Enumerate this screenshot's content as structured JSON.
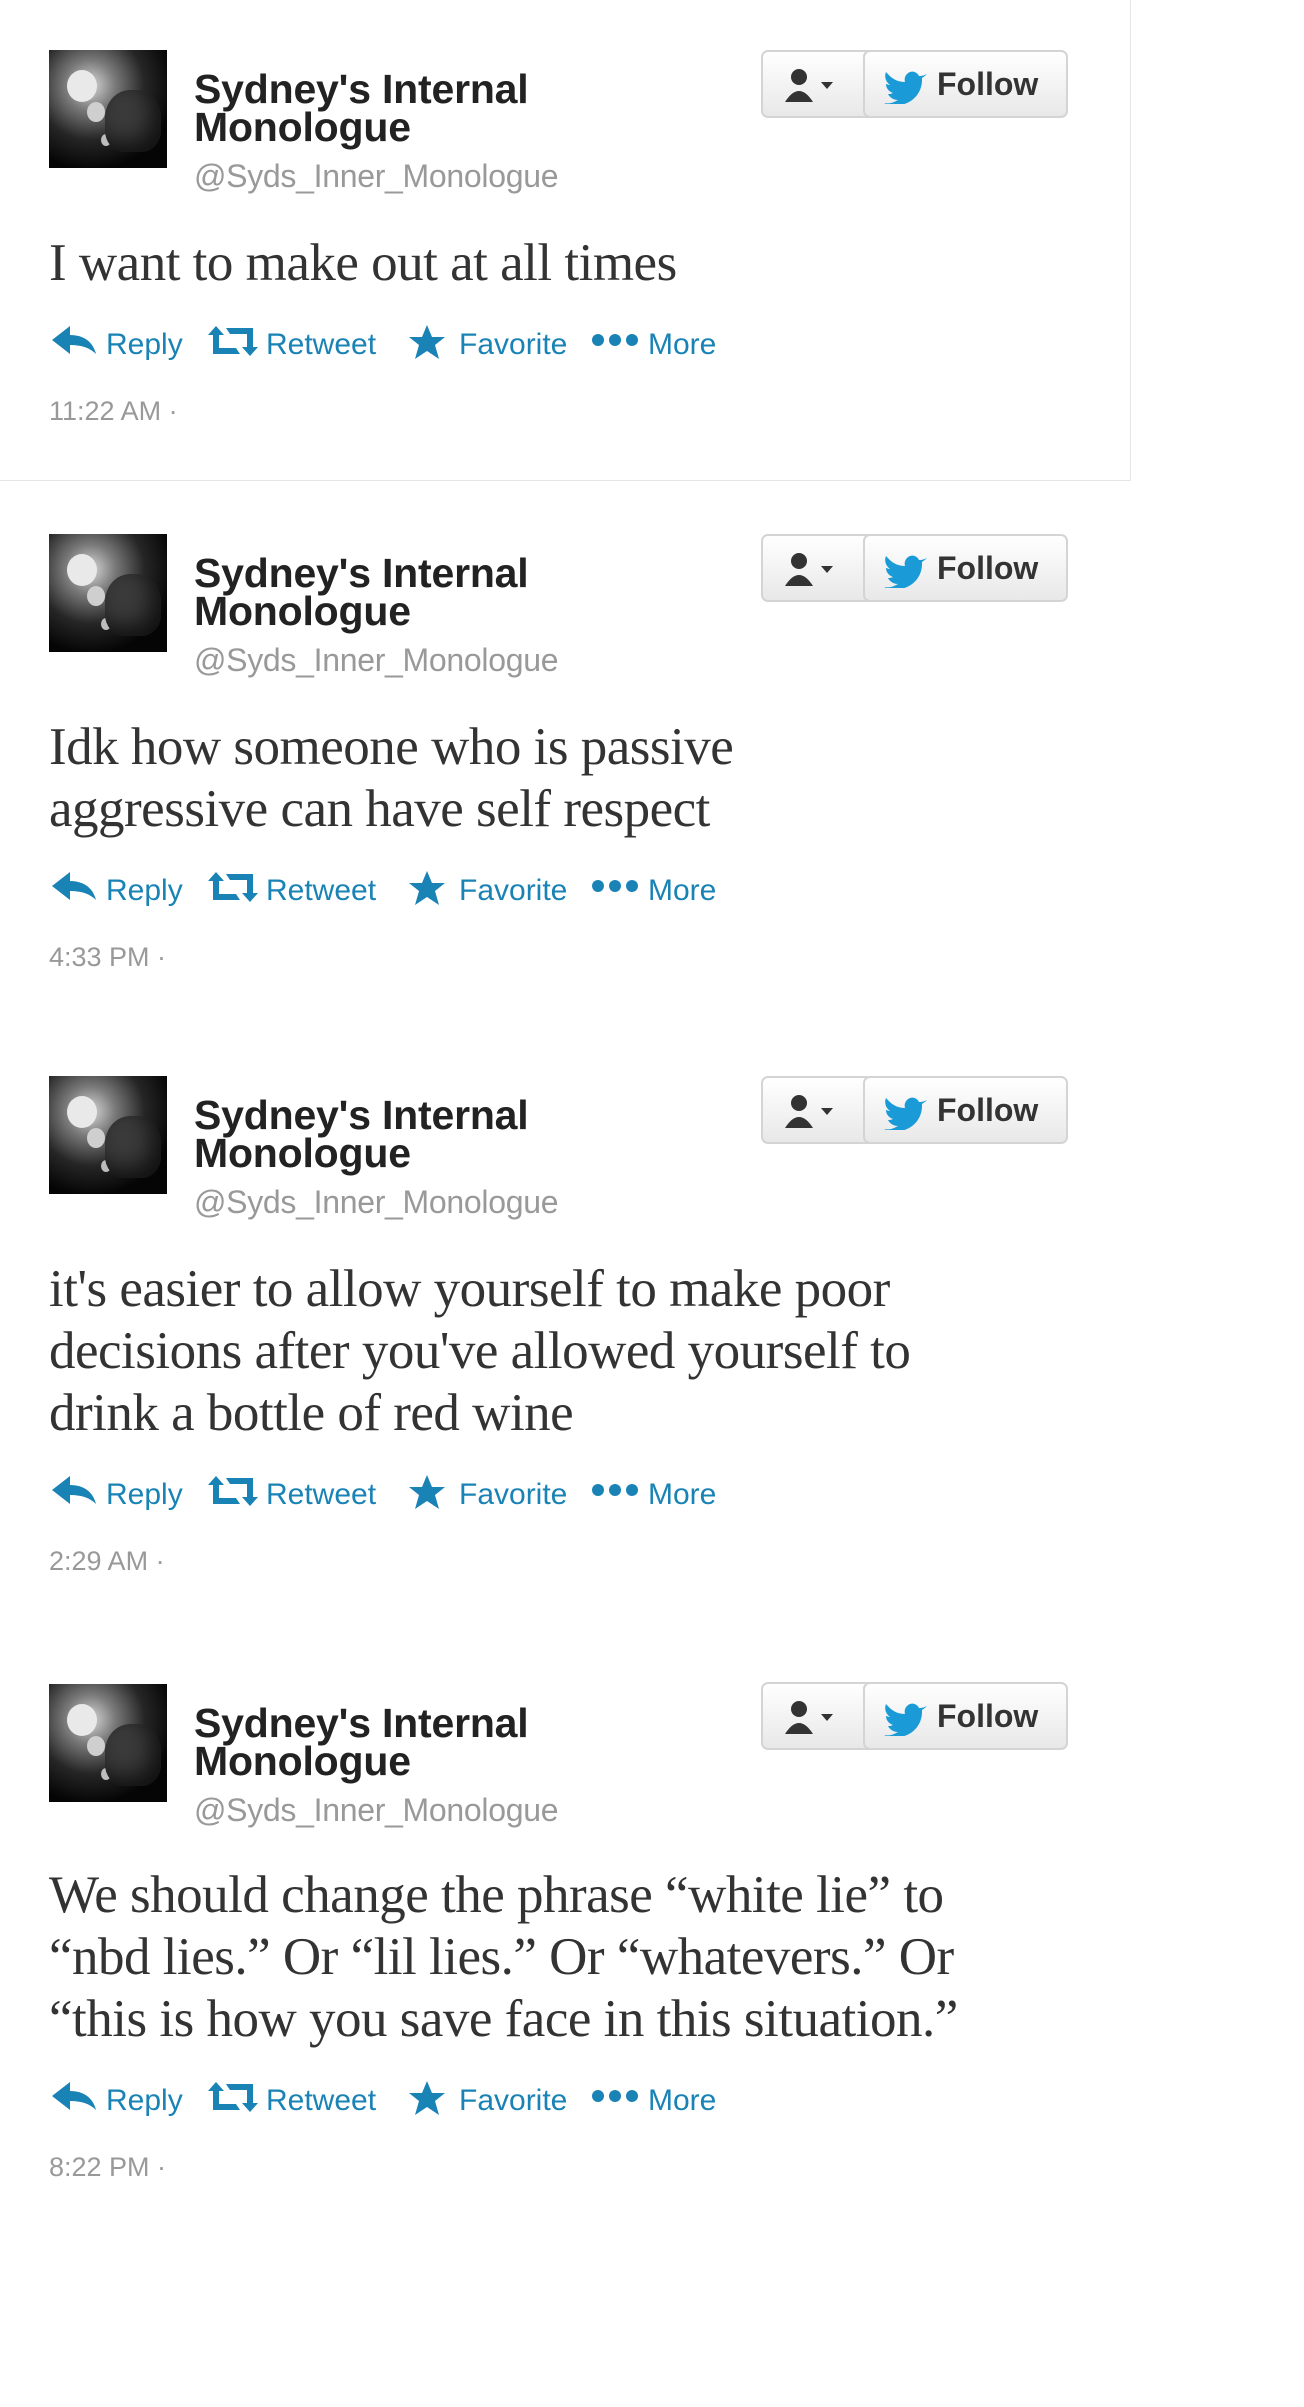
{
  "colors": {
    "accent": "#1a83b5",
    "text": "#333333",
    "muted": "#999999"
  },
  "actions": {
    "reply": "Reply",
    "retweet": "Retweet",
    "favorite": "Favorite",
    "more": "More"
  },
  "icons": {
    "reply": "reply-arrow-icon",
    "retweet": "retweet-icon",
    "favorite": "star-icon",
    "more": "ellipsis-icon",
    "user": "user-dropdown-icon",
    "bird": "twitter-bird-icon"
  },
  "tweets": [
    {
      "name_line1": "Sydney's Internal",
      "name_line2": "Monologue",
      "handle": "@Syds_Inner_Monologue",
      "follow_label": "Follow",
      "lines": [
        "I want to make out at all times"
      ],
      "time": "11:22 AM ·"
    },
    {
      "name_line1": "Sydney's Internal",
      "name_line2": "Monologue",
      "handle": "@Syds_Inner_Monologue",
      "follow_label": "Follow",
      "lines": [
        "Idk how someone who is passive",
        "aggressive can have self respect"
      ],
      "time": "4:33 PM ·"
    },
    {
      "name_line1": "Sydney's Internal",
      "name_line2": "Monologue",
      "handle": "@Syds_Inner_Monologue",
      "follow_label": "Follow",
      "lines": [
        "it's easier to allow yourself to make poor",
        "decisions after you've allowed yourself to",
        "drink a bottle of red wine"
      ],
      "time": "2:29 AM ·"
    },
    {
      "name_line1": "Sydney's Internal",
      "name_line2": "Monologue",
      "handle": "@Syds_Inner_Monologue",
      "follow_label": "Follow",
      "lines": [
        "We should change the phrase “white lie” to",
        "“nbd lies.” Or “lil lies.” Or “whatevers.” Or",
        "“this is how you save face in this situation.”"
      ],
      "time": "8:22 PM ·"
    }
  ]
}
